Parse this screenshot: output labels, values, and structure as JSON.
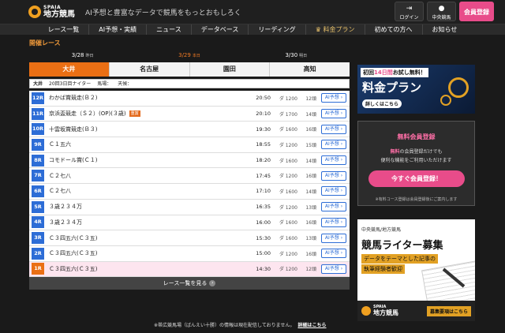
{
  "header": {
    "logo_top": "SPAIA",
    "logo_main": "地方競馬",
    "tagline": "AI予想と豊富なデータで競馬をもっとおもしろく",
    "login_label": "ログイン",
    "central_label": "中央競馬",
    "register_label": "会員登録"
  },
  "nav": {
    "items": [
      "レース一覧",
      "AI予想・実績",
      "ニュース",
      "データベース",
      "リーディング",
      "料金プラン",
      "初めての方へ",
      "お知らせ"
    ]
  },
  "main": {
    "section_title": "開催レース",
    "dates": [
      {
        "date": "3/28",
        "day": "昨日"
      },
      {
        "date": "3/29",
        "day": "本日"
      },
      {
        "date": "3/30",
        "day": "明日"
      }
    ],
    "venues": [
      "大井",
      "名古屋",
      "園田",
      "高知"
    ],
    "meeting": {
      "track": "大井",
      "meeting": "20回3日目ナイター",
      "baba": "馬場：",
      "weather": "天候："
    },
    "races": [
      {
        "num": "12R",
        "name": "わかば賞競走(Ｂ２)",
        "grade": "",
        "time": "20:50",
        "dist": "ダ 1200",
        "heads": "12頭",
        "ai": "AI予想"
      },
      {
        "num": "11R",
        "name": "京浜盃競走（Ｓ２）(OP)(３歳)",
        "grade": "重賞",
        "time": "20:10",
        "dist": "ダ 1700",
        "heads": "14頭",
        "ai": "AI予想"
      },
      {
        "num": "10R",
        "name": "十雲坂賞競走(Ｂ３)",
        "grade": "",
        "time": "19:30",
        "dist": "ダ 1600",
        "heads": "16頭",
        "ai": "AI予想"
      },
      {
        "num": "9R",
        "name": "Ｃ１五六",
        "grade": "",
        "time": "18:55",
        "dist": "ダ 1200",
        "heads": "15頭",
        "ai": "AI予想"
      },
      {
        "num": "8R",
        "name": "コモドール賞(Ｃ１)",
        "grade": "",
        "time": "18:20",
        "dist": "ダ 1600",
        "heads": "14頭",
        "ai": "AI予想"
      },
      {
        "num": "7R",
        "name": "Ｃ２七八",
        "grade": "",
        "time": "17:45",
        "dist": "ダ 1200",
        "heads": "16頭",
        "ai": "AI予想"
      },
      {
        "num": "6R",
        "name": "Ｃ２七八",
        "grade": "",
        "time": "17:10",
        "dist": "ダ 1600",
        "heads": "14頭",
        "ai": "AI予想"
      },
      {
        "num": "5R",
        "name": "３歳２３４万",
        "grade": "",
        "time": "16:35",
        "dist": "ダ 1200",
        "heads": "13頭",
        "ai": "AI予想"
      },
      {
        "num": "4R",
        "name": "３歳２３４万",
        "grade": "",
        "time": "16:00",
        "dist": "ダ 1600",
        "heads": "16頭",
        "ai": "AI予想"
      },
      {
        "num": "3R",
        "name": "Ｃ３四五六(Ｃ３五)",
        "grade": "",
        "time": "15:30",
        "dist": "ダ 1600",
        "heads": "13頭",
        "ai": "AI予想"
      },
      {
        "num": "2R",
        "name": "Ｃ３四五六(Ｃ３五)",
        "grade": "",
        "time": "15:00",
        "dist": "ダ 1200",
        "heads": "16頭",
        "ai": "AI予想"
      },
      {
        "num": "1R",
        "name": "Ｃ３四五六(Ｃ３五)",
        "grade": "",
        "time": "14:30",
        "dist": "ダ 1200",
        "heads": "12頭",
        "ai": "AI予想"
      }
    ],
    "more_label": "レース一覧を見る",
    "note": "※帯広競馬場（ばんえい十勝）の情報は現在配信しておりません。",
    "note_link": "詳細はこちら"
  },
  "side": {
    "ad1": {
      "free_pre": "初回",
      "free_days": "14日間",
      "free_post": "お試し無料！",
      "title": "料金プラン",
      "detail": "詳しくはこちら"
    },
    "ad2": {
      "title": "無料会員登録",
      "desc_strong": "無料",
      "desc1": "の会員登録だけでも",
      "desc2": "便利な機能をご利用いただけます",
      "button": "今すぐ会員登録！",
      "note": "※有料コース登録は会員登録後にご案内します"
    },
    "ad3": {
      "kicker": "中央競馬/地方競馬",
      "title": "競馬ライター募集",
      "sub1": "データをテーマとした記事の",
      "sub2": "執筆経験者歓迎",
      "logo_top": "SPAIA",
      "logo_main": "地方競馬",
      "req": "募集要項はこちら"
    }
  },
  "colors": {
    "accent": "#ea6f14",
    "pink": "#e84c8a",
    "race_blue": "#2d6dd6",
    "gold": "#e7c06a"
  }
}
